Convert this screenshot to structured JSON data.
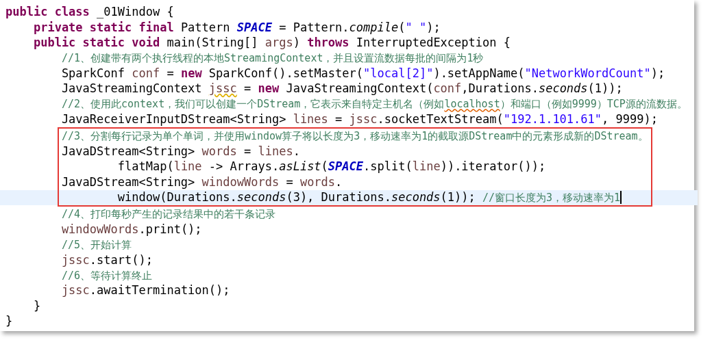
{
  "lines": [
    {
      "kind": "line",
      "current": false,
      "tokens": [
        {
          "text": "public class",
          "kind": "keyword"
        },
        {
          "text": " _01Window {",
          "kind": "plain"
        }
      ],
      "children": [
        {
          "kind": "line",
          "current": false,
          "tokens": [
            {
              "text": "private static final",
              "kind": "keyword"
            },
            {
              "text": " Pattern ",
              "kind": "plain"
            },
            {
              "text": "SPACE",
              "kind": "static_field"
            },
            {
              "text": " = Pattern.",
              "kind": "plain"
            },
            {
              "text": "compile",
              "kind": "static_method"
            },
            {
              "text": "(",
              "kind": "plain"
            },
            {
              "text": "\" \"",
              "kind": "string"
            },
            {
              "text": ");",
              "kind": "plain"
            }
          ]
        },
        {
          "kind": "line",
          "current": false,
          "tokens": [
            {
              "text": "public static void",
              "kind": "keyword"
            },
            {
              "text": " main(String[] ",
              "kind": "plain"
            },
            {
              "text": "args",
              "kind": "local"
            },
            {
              "text": ") ",
              "kind": "plain"
            },
            {
              "text": "throws",
              "kind": "keyword"
            },
            {
              "text": " InterruptedException {",
              "kind": "plain"
            }
          ],
          "children": [
            {
              "kind": "line",
              "current": false,
              "tokens": [
                {
                  "text": "//1、创建带有两个执行线程的本地StreamingContext，并且设置流数据每批的间隔为1秒",
                  "kind": "comment"
                }
              ]
            },
            {
              "kind": "line",
              "current": false,
              "tokens": [
                {
                  "text": "SparkConf ",
                  "kind": "plain"
                },
                {
                  "text": "conf",
                  "kind": "local"
                },
                {
                  "text": " = ",
                  "kind": "plain"
                },
                {
                  "text": "new",
                  "kind": "keyword"
                },
                {
                  "text": " SparkConf().setMaster(",
                  "kind": "plain"
                },
                {
                  "text": "\"local[2]\"",
                  "kind": "string"
                },
                {
                  "text": ").setAppName(",
                  "kind": "plain"
                },
                {
                  "text": "\"NetworkWordCount\"",
                  "kind": "string"
                },
                {
                  "text": ");",
                  "kind": "plain"
                }
              ]
            },
            {
              "kind": "line",
              "current": false,
              "tokens": [
                {
                  "text": "JavaStreamingContext ",
                  "kind": "plain"
                },
                {
                  "text": "jssc",
                  "kind": "local_warning"
                },
                {
                  "text": " = ",
                  "kind": "plain"
                },
                {
                  "text": "new",
                  "kind": "keyword"
                },
                {
                  "text": " JavaStreamingContext(",
                  "kind": "plain"
                },
                {
                  "text": "conf",
                  "kind": "local"
                },
                {
                  "text": ",Durations.",
                  "kind": "plain"
                },
                {
                  "text": "seconds",
                  "kind": "static_method"
                },
                {
                  "text": "(1));",
                  "kind": "plain"
                }
              ]
            },
            {
              "kind": "line",
              "current": false,
              "tokens": [
                {
                  "text": "//2、使用此context，我们可以创建一个DStream，它表示来自特定主机名（例如",
                  "kind": "comment"
                },
                {
                  "text": "localhost",
                  "kind": "comment_warning"
                },
                {
                  "text": "）和端口（例如9999）TCP源的流数据。",
                  "kind": "comment"
                }
              ]
            },
            {
              "kind": "line",
              "current": false,
              "tokens": [
                {
                  "text": "JavaReceiverInputDStream<String> ",
                  "kind": "plain"
                },
                {
                  "text": "lines",
                  "kind": "local"
                },
                {
                  "text": " = ",
                  "kind": "plain"
                },
                {
                  "text": "jssc",
                  "kind": "local"
                },
                {
                  "text": ".socketTextStream(",
                  "kind": "plain"
                },
                {
                  "text": "\"192.1.101.61\"",
                  "kind": "string"
                },
                {
                  "text": ", 9999);",
                  "kind": "plain"
                }
              ]
            },
            {
              "kind": "group",
              "children": [
                {
                  "kind": "line",
                  "current": false,
                  "tokens": [
                    {
                      "text": "//3、分割每行记录为单个单词，并使用window算子将以长度为3，移动速率为1的截取源DStream中的元素形成新的DStream。",
                      "kind": "comment"
                    }
                  ]
                },
                {
                  "kind": "line",
                  "current": false,
                  "tokens": [
                    {
                      "text": "JavaDStream<String> ",
                      "kind": "plain"
                    },
                    {
                      "text": "words",
                      "kind": "local"
                    },
                    {
                      "text": " = ",
                      "kind": "plain"
                    },
                    {
                      "text": "lines",
                      "kind": "local"
                    },
                    {
                      "text": ".",
                      "kind": "plain"
                    }
                  ],
                  "children": [
                    {
                      "kind": "wrapped",
                      "current": false,
                      "tokens": [
                        {
                          "text": "flatMap(",
                          "kind": "plain"
                        },
                        {
                          "text": "line",
                          "kind": "local"
                        },
                        {
                          "text": " -> Arrays.",
                          "kind": "plain"
                        },
                        {
                          "text": "asList",
                          "kind": "static_method"
                        },
                        {
                          "text": "(",
                          "kind": "plain"
                        },
                        {
                          "text": "SPACE",
                          "kind": "static_field"
                        },
                        {
                          "text": ".split(",
                          "kind": "plain"
                        },
                        {
                          "text": "line",
                          "kind": "local"
                        },
                        {
                          "text": ")).iterator());",
                          "kind": "plain"
                        }
                      ]
                    }
                  ]
                },
                {
                  "kind": "line",
                  "current": false,
                  "tokens": [
                    {
                      "text": "JavaDStream<String> ",
                      "kind": "plain"
                    },
                    {
                      "text": "windowWords",
                      "kind": "local"
                    },
                    {
                      "text": " = ",
                      "kind": "plain"
                    },
                    {
                      "text": "words",
                      "kind": "local"
                    },
                    {
                      "text": ".",
                      "kind": "plain"
                    }
                  ],
                  "children": [
                    {
                      "kind": "wrapped",
                      "current": true,
                      "tokens": [
                        {
                          "text": "window(Durations.",
                          "kind": "plain"
                        },
                        {
                          "text": "seconds",
                          "kind": "static_method"
                        },
                        {
                          "text": "(3), Durations.",
                          "kind": "plain"
                        },
                        {
                          "text": "seconds",
                          "kind": "static_method"
                        },
                        {
                          "text": "(1)); ",
                          "kind": "plain"
                        },
                        {
                          "text": "//窗口长度为3，移动速率为1",
                          "kind": "comment"
                        }
                      ]
                    }
                  ]
                }
              ]
            },
            {
              "kind": "line",
              "current": false,
              "tokens": [
                {
                  "text": "//4、打印每秒产生的记录结果中的若干条记录",
                  "kind": "comment"
                }
              ]
            },
            {
              "kind": "line",
              "current": false,
              "tokens": [
                {
                  "text": "windowWords",
                  "kind": "local"
                },
                {
                  "text": ".print();",
                  "kind": "plain"
                }
              ]
            },
            {
              "kind": "line",
              "current": false,
              "tokens": [
                {
                  "text": "//5、开始计算",
                  "kind": "comment"
                }
              ]
            },
            {
              "kind": "line",
              "current": false,
              "tokens": [
                {
                  "text": "jssc",
                  "kind": "local"
                },
                {
                  "text": ".start();",
                  "kind": "plain"
                }
              ]
            },
            {
              "kind": "line",
              "current": false,
              "tokens": [
                {
                  "text": "//6、等待计算终止",
                  "kind": "comment"
                }
              ]
            },
            {
              "kind": "line",
              "current": false,
              "tokens": [
                {
                  "text": "jssc",
                  "kind": "local"
                },
                {
                  "text": ".awaitTermination();",
                  "kind": "plain"
                }
              ]
            }
          ]
        },
        {
          "kind": "line",
          "current": false,
          "tokens": [
            {
              "text": "}",
              "kind": "plain"
            }
          ]
        }
      ]
    },
    {
      "kind": "line",
      "current": false,
      "tokens": [
        {
          "text": "}",
          "kind": "plain"
        }
      ]
    }
  ]
}
